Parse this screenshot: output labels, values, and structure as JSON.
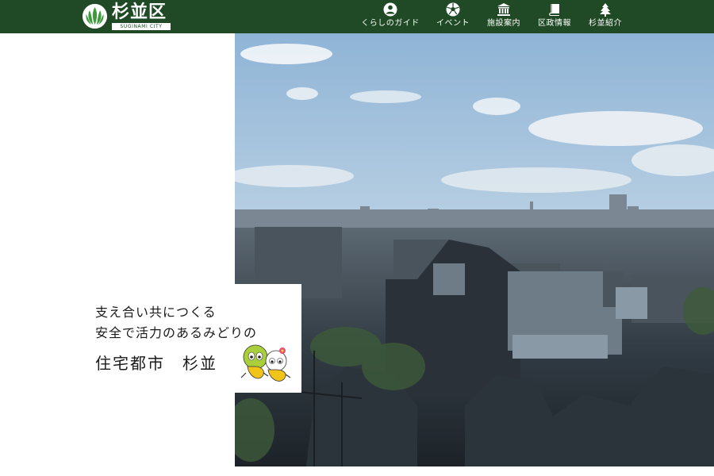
{
  "header": {
    "logo": {
      "name": "杉並区",
      "subtitle": "SUGINAMI CITY"
    },
    "nav": [
      {
        "label": "くらしのガイド",
        "icon": "person-icon"
      },
      {
        "label": "イベント",
        "icon": "soccer-ball-icon"
      },
      {
        "label": "施設案内",
        "icon": "building-icon"
      },
      {
        "label": "区政情報",
        "icon": "book-icon"
      },
      {
        "label": "杉並紹介",
        "icon": "tree-icon"
      }
    ]
  },
  "hero": {
    "image": "city-skyline-photo"
  },
  "caption": {
    "line1": "支え合い共につくる",
    "line2": "安全で活力のあるみどりの",
    "line3": "住宅都市　杉並"
  },
  "colors": {
    "header_bg": "#1f4a25",
    "nav_text": "#ffffff",
    "caption_text": "#1a1a1a"
  }
}
